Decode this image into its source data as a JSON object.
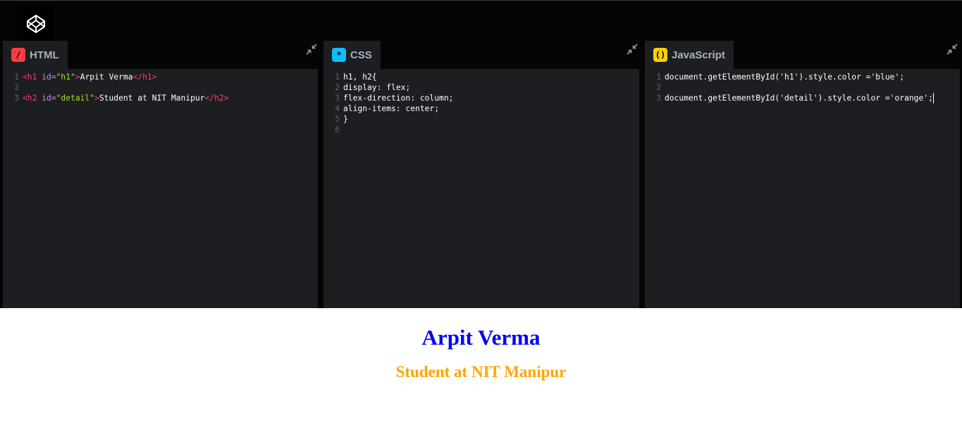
{
  "app": {
    "logo_icon": "codepen-logo-icon"
  },
  "editors": {
    "html": {
      "tab_label": "HTML",
      "badge": "/",
      "badge_color": "#ff3c41",
      "line_numbers": [
        "1",
        "2",
        "3"
      ],
      "line1": {
        "open_tag": "<h1 ",
        "attr": "id=",
        "value": "\"h1\"",
        "close": ">",
        "text": "Arpit Verma",
        "end_tag": "</h1>"
      },
      "line3": {
        "open_tag": "<h2 ",
        "attr": "id=",
        "value": "\"detail\"",
        "close": ">",
        "text": "Student at NIT Manipur",
        "end_tag": "</h2>"
      }
    },
    "css": {
      "tab_label": "CSS",
      "badge": "*",
      "badge_color": "#0ebeff",
      "line_numbers": [
        "1",
        "2",
        "3",
        "4",
        "5",
        "6"
      ],
      "lines": [
        "h1, h2{",
        "display: flex;",
        "flex-direction: column;",
        "align-items: center;",
        "}",
        ""
      ]
    },
    "js": {
      "tab_label": "JavaScript",
      "badge": "()",
      "badge_color": "#fcd000",
      "line_numbers": [
        "1",
        "2",
        "3"
      ],
      "lines": [
        "document.getElementById('h1').style.color ='blue';",
        "",
        "document.getElementById('detail').style.color ='orange';"
      ]
    }
  },
  "preview": {
    "heading": "Arpit Verma",
    "heading_color": "#0000ff",
    "subheading": "Student at NIT Manipur",
    "subheading_color": "#ffa500"
  }
}
